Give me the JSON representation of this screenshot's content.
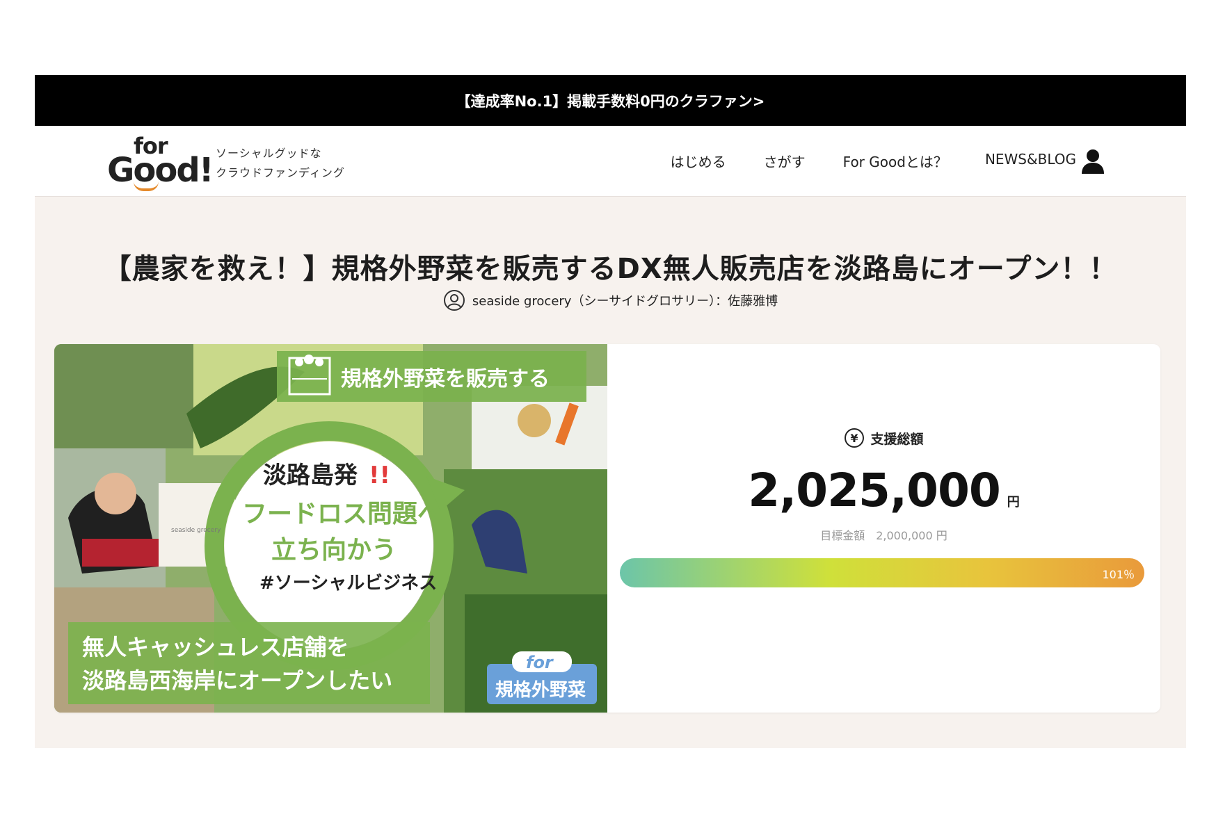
{
  "banner": {
    "text": "【達成率No.1】掲載手数料0円のクラファン>"
  },
  "header": {
    "logo_for": "for",
    "logo_good": "Good!",
    "tagline_line1": "ソーシャルグッドな",
    "tagline_line2": "クラウドファンディング",
    "nav": [
      "はじめる",
      "さがす",
      "For Goodとは？",
      "NEWS&BLOG"
    ],
    "user_icon": "user-icon"
  },
  "project": {
    "title": "【農家を救え！】規格外野菜を販売するDX無人販売店を淡路島にオープン！！",
    "owner": "seaside grocery（シーサイドグロサリー）：佐藤雅博"
  },
  "hero": {
    "top_label": "規格外野菜を販売する",
    "center_line1": "淡路島発",
    "center_line1_mark": "!!",
    "center_line2": "フードロス問題へ",
    "center_line3": "立ち向かう",
    "center_line4": "#ソーシャルビジネス",
    "bottom_line1": "無人キャッシュレス店舗を",
    "bottom_line2": "淡路島西海岸にオープンしたい",
    "badge_for": "for",
    "badge_text": "規格外野菜",
    "box_label": "seaside grocery"
  },
  "stats": {
    "label": "支援総額",
    "amount": "2,025,000",
    "unit": "円",
    "goal": "目標金額　2,000,000 円",
    "progress_label": "101％",
    "progress_fraction": 1.0
  },
  "colors": {
    "accent_green": "#7bb24e",
    "logo_orange": "#e58a2b",
    "banner_bg": "#000000"
  }
}
